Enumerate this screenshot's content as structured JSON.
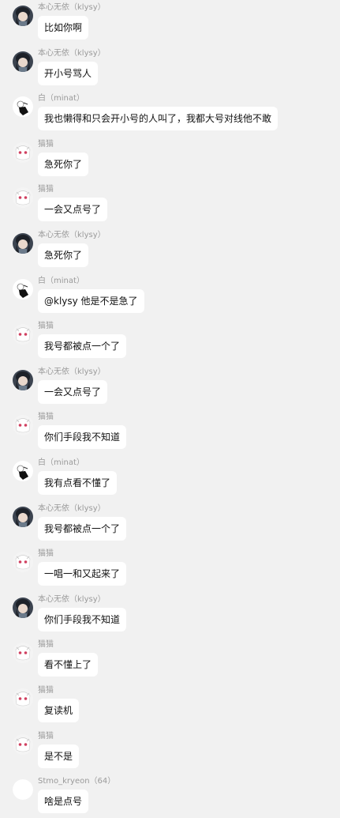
{
  "messages": [
    {
      "sender": "本心无依（klysy）",
      "avatar": "klysy",
      "text": "比如你啊"
    },
    {
      "sender": "本心无依（klysy）",
      "avatar": "klysy",
      "text": "开小号骂人"
    },
    {
      "sender": "白（minat）",
      "avatar": "minat",
      "text": "我也懒得和只会开小号的人叫了，我都大号对线他不敢"
    },
    {
      "sender": "猫猫",
      "avatar": "cat",
      "text": "急死你了"
    },
    {
      "sender": "猫猫",
      "avatar": "cat",
      "text": "一会又点号了"
    },
    {
      "sender": "本心无依（klysy）",
      "avatar": "klysy",
      "text": "急死你了"
    },
    {
      "sender": "白（minat）",
      "avatar": "minat",
      "text": "@klysy 他是不是急了"
    },
    {
      "sender": "猫猫",
      "avatar": "cat",
      "text": "我号都被点一个了"
    },
    {
      "sender": "本心无依（klysy）",
      "avatar": "klysy",
      "text": "一会又点号了"
    },
    {
      "sender": "猫猫",
      "avatar": "cat",
      "text": "你们手段我不知道"
    },
    {
      "sender": "白（minat）",
      "avatar": "minat",
      "text": "我有点看不懂了"
    },
    {
      "sender": "本心无依（klysy）",
      "avatar": "klysy",
      "text": "我号都被点一个了"
    },
    {
      "sender": "猫猫",
      "avatar": "cat",
      "text": "一唱一和又起来了"
    },
    {
      "sender": "本心无依（klysy）",
      "avatar": "klysy",
      "text": "你们手段我不知道"
    },
    {
      "sender": "猫猫",
      "avatar": "cat",
      "text": "看不懂上了"
    },
    {
      "sender": "猫猫",
      "avatar": "cat",
      "text": "复读机"
    },
    {
      "sender": "猫猫",
      "avatar": "cat",
      "text": "是不是"
    },
    {
      "sender": "Stmo_kryeon（64）",
      "avatar": "blank",
      "text": "啥是点号"
    }
  ]
}
